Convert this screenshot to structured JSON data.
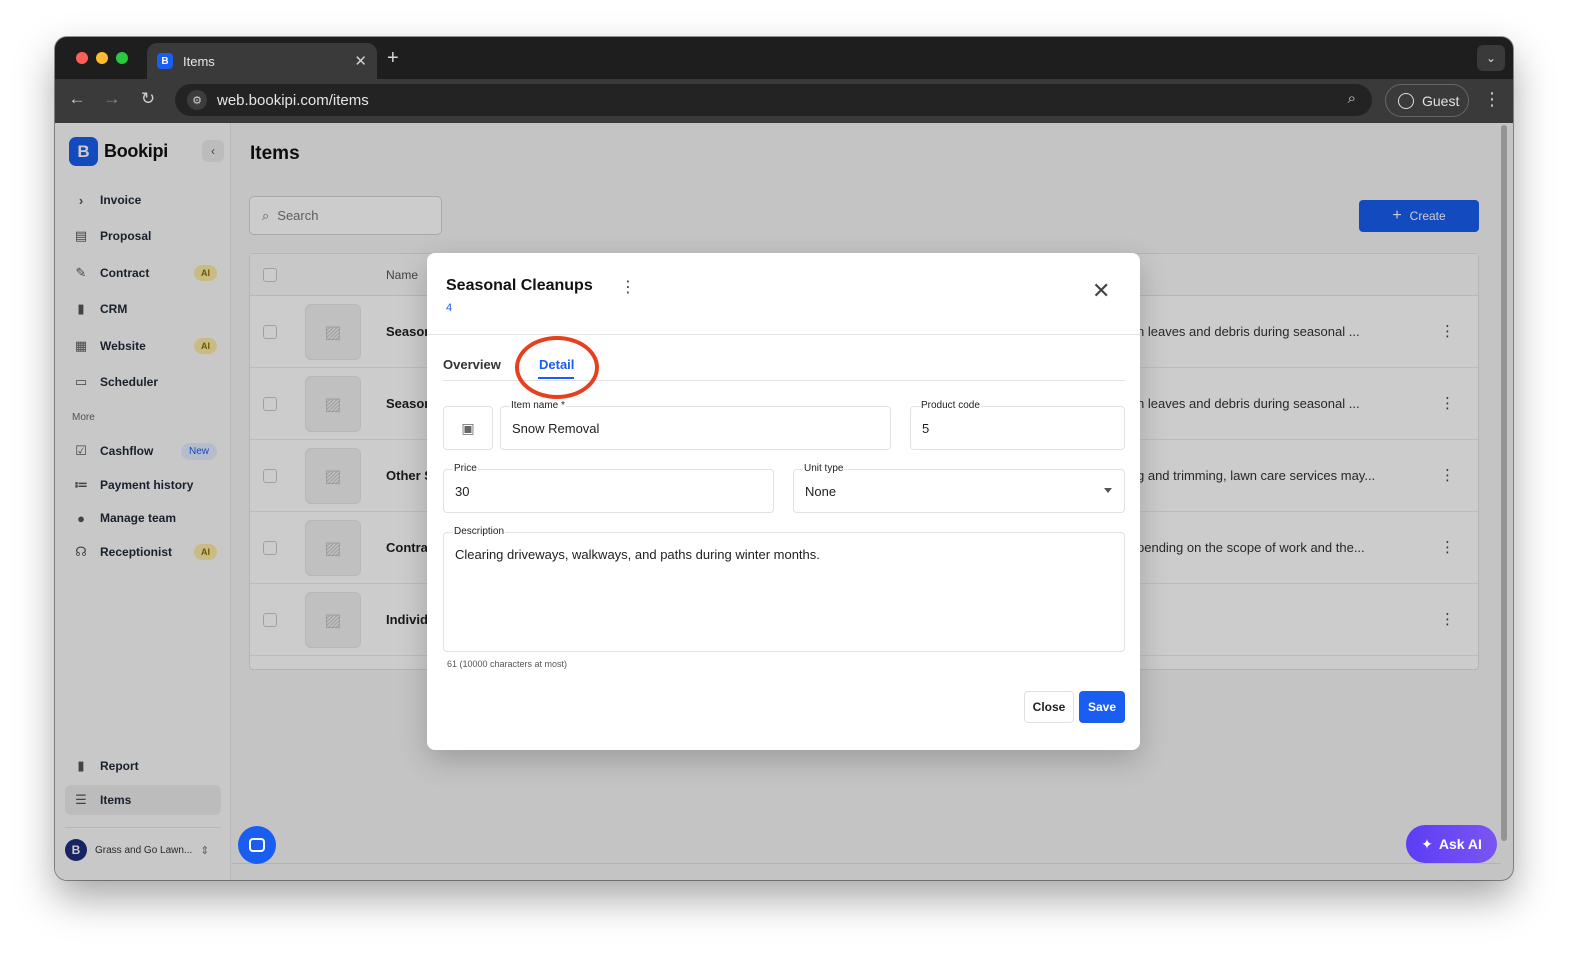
{
  "browser": {
    "tab_title": "Items",
    "url": "web.bookipi.com/items",
    "profile_label": "Guest"
  },
  "sidebar": {
    "brand": "Bookipi",
    "items": [
      {
        "label": "Invoice",
        "icon": "chevron-right-icon"
      },
      {
        "label": "Proposal",
        "icon": "proposal-icon"
      },
      {
        "label": "Contract",
        "icon": "contract-icon",
        "badge": "AI"
      },
      {
        "label": "CRM",
        "icon": "crm-icon"
      },
      {
        "label": "Website",
        "icon": "website-icon",
        "badge": "AI"
      },
      {
        "label": "Scheduler",
        "icon": "calendar-icon"
      }
    ],
    "more_label": "More",
    "more_items": [
      {
        "label": "Cashflow",
        "icon": "cashflow-icon",
        "badge": "New"
      },
      {
        "label": "Payment history",
        "icon": "payment-history-icon"
      },
      {
        "label": "Manage team",
        "icon": "team-icon"
      },
      {
        "label": "Receptionist",
        "icon": "headset-icon",
        "badge": "AI"
      }
    ],
    "bottom_items": [
      {
        "label": "Report",
        "icon": "report-icon"
      },
      {
        "label": "Items",
        "icon": "items-icon",
        "active": true
      }
    ],
    "workspace": "Grass and Go Lawn...",
    "workspace_initial": "B"
  },
  "main": {
    "title": "Items",
    "search_placeholder": "Search",
    "create_label": "Create",
    "table": {
      "name_header": "Name",
      "rows": [
        {
          "name": "Seasor",
          "desc": "n leaves and debris during seasonal ..."
        },
        {
          "name": "Seasor",
          "desc": "n leaves and debris during seasonal ..."
        },
        {
          "name": "Other S",
          "desc": "g and trimming, lawn care services may..."
        },
        {
          "name": "Contra",
          "desc": "pending on the scope of work and the..."
        },
        {
          "name": "Individ",
          "desc": ""
        }
      ]
    },
    "ask_ai": "Ask AI"
  },
  "modal": {
    "title": "Seasonal Cleanups",
    "subtitle": "4",
    "tabs": {
      "overview": "Overview",
      "detail": "Detail"
    },
    "fields": {
      "item_name_label": "Item name *",
      "item_name_value": "Snow Removal",
      "product_code_label": "Product code",
      "product_code_value": "5",
      "price_label": "Price",
      "price_value": "30",
      "unit_type_label": "Unit type",
      "unit_type_value": "None",
      "description_label": "Description",
      "description_value": "Clearing driveways, walkways, and paths during winter months."
    },
    "char_count": "61 (10000 characters at most)",
    "close_label": "Close",
    "save_label": "Save"
  },
  "colors": {
    "accent": "#1a5df1",
    "highlight_ring": "#e8401e",
    "ai_badge_bg": "#fbeaa6",
    "ask_ai_gradient": [
      "#5b3df5",
      "#7b55f2"
    ]
  }
}
